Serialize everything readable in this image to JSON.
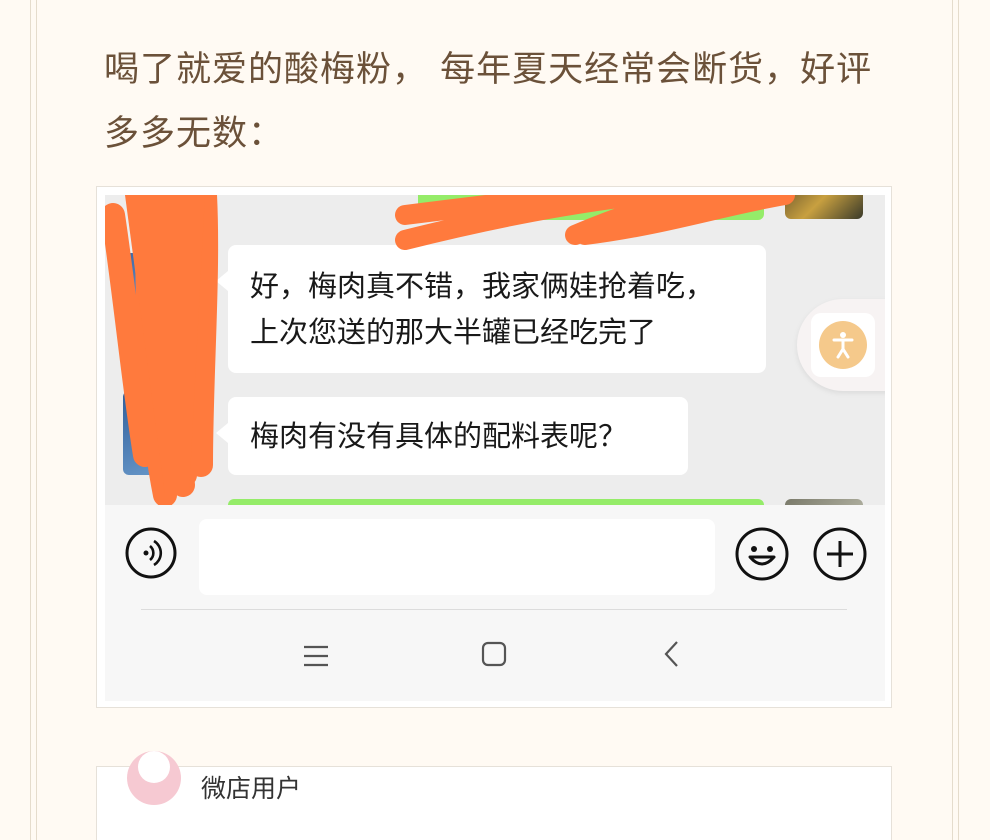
{
  "article": {
    "intro_text": "喝了就爱的酸梅粉， 每年夏天经常会断货，好评多多无数："
  },
  "chat": {
    "messages": [
      {
        "side": "left",
        "text_line1": "好，梅肉真不错，我家俩娃抢着吃，",
        "text_line2": "上次您送的那大半罐已经吃完了"
      },
      {
        "side": "left",
        "text": "梅肉有没有具体的配料表呢？"
      }
    ],
    "bubble_colors": {
      "received": "#ffffff",
      "sent": "#95ec69"
    },
    "input_placeholder": "",
    "icons": {
      "voice": "voice-icon",
      "emoji": "emoji-icon",
      "plus": "plus-icon",
      "accessibility": "accessibility-icon",
      "menu": "menu-icon",
      "home": "home-icon",
      "back": "back-icon"
    },
    "redaction_color": "#ff7a3d"
  },
  "review": {
    "user_name": "微店用户"
  }
}
